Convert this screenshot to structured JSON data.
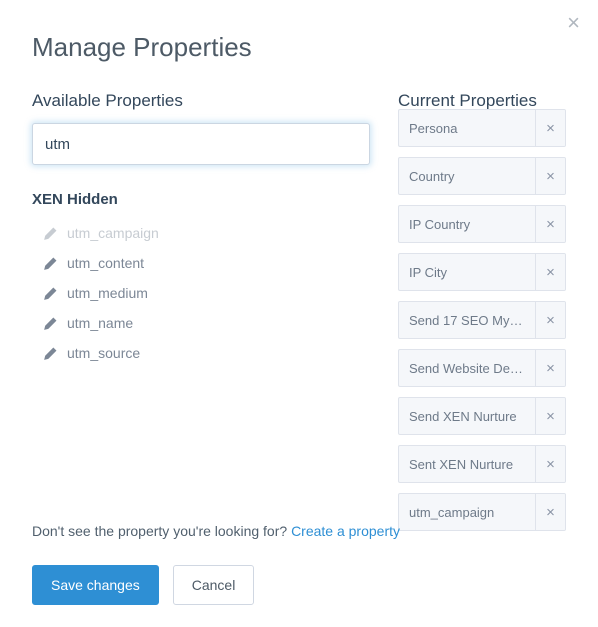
{
  "modal": {
    "title": "Manage Properties",
    "close_icon": "×"
  },
  "available": {
    "heading": "Available Properties",
    "search_value": "utm",
    "group_title": "XEN Hidden",
    "items": [
      {
        "label": "utm_campaign",
        "disabled": true
      },
      {
        "label": "utm_content",
        "disabled": false
      },
      {
        "label": "utm_medium",
        "disabled": false
      },
      {
        "label": "utm_name",
        "disabled": false
      },
      {
        "label": "utm_source",
        "disabled": false
      }
    ]
  },
  "current": {
    "heading": "Current Properties",
    "items": [
      {
        "label": "Persona",
        "cut": true
      },
      {
        "label": "Country"
      },
      {
        "label": "IP Country"
      },
      {
        "label": "IP City"
      },
      {
        "label": "Send 17 SEO My…"
      },
      {
        "label": "Send Website De…"
      },
      {
        "label": "Send XEN Nurture"
      },
      {
        "label": "Sent XEN Nurture"
      },
      {
        "label": "utm_campaign"
      }
    ],
    "remove_icon": "×"
  },
  "footer": {
    "hint_text": "Don't see the property you're looking for? ",
    "create_link": "Create a property",
    "save_label": "Save changes",
    "cancel_label": "Cancel"
  }
}
